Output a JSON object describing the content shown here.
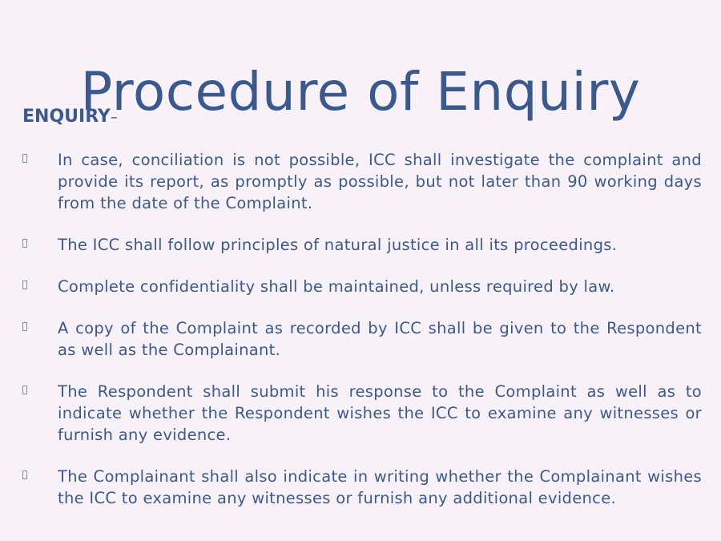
{
  "slide": {
    "title": "Procedure of Enquiry",
    "heading": "ENQUIRY",
    "heading_suffix": "–",
    "bullets": [
      "In case, conciliation is not possible, ICC shall investigate the complaint and provide its report, as promptly as possible, but not later than 90 working days from the date of the Complaint.",
      "The ICC shall follow principles of natural justice in all its proceedings.",
      "Complete confidentiality shall be maintained, unless required by law.",
      "A copy of the Complaint as recorded by ICC shall be given to the Respondent as well as the Complainant.",
      "The Respondent shall submit his response to the Complaint as well as to indicate whether the Respondent wishes the ICC to examine any witnesses or furnish any evidence.",
      "The Complainant shall also indicate in writing whether the Complainant wishes the ICC to examine any witnesses or furnish any additional evidence."
    ],
    "bullet_icon": "square-bullet-icon"
  }
}
